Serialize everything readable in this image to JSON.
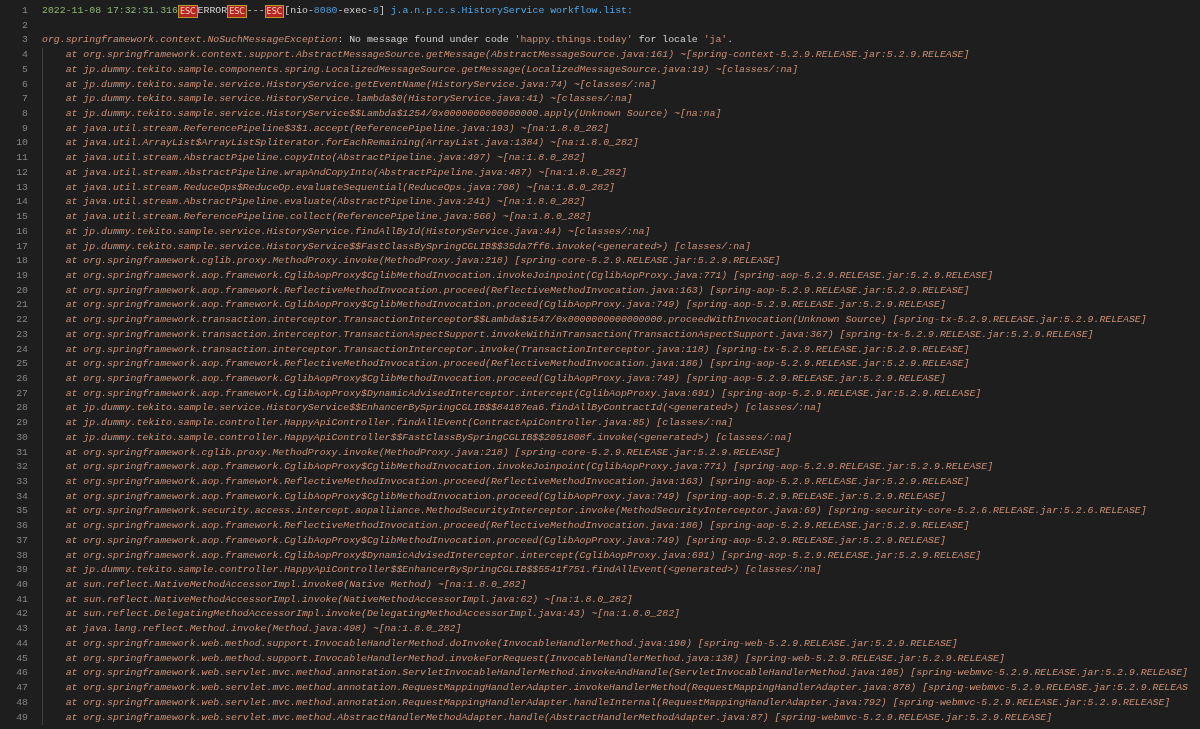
{
  "lines": [
    {
      "number": "1",
      "kind": "header",
      "segments": [
        {
          "kind": "timestamp",
          "text": "2022-11-08 17:32:31.316"
        },
        {
          "kind": "esc",
          "text": "ESC"
        },
        {
          "kind": "level",
          "text": "ERROR"
        },
        {
          "kind": "esc",
          "text": "ESC"
        },
        {
          "kind": "separator",
          "text": "---"
        },
        {
          "kind": "esc",
          "text": "ESC"
        },
        {
          "kind": "thread",
          "parts": [
            {
              "kind": "plain",
              "text": "[nio-"
            },
            {
              "kind": "number",
              "text": "8080"
            },
            {
              "kind": "plain",
              "text": "-exec-"
            },
            {
              "kind": "number",
              "text": "8"
            },
            {
              "kind": "plain",
              "text": "]"
            }
          ]
        },
        {
          "kind": "logger",
          "text": " j.a.n.p.c.s.HistoryService workflow.list:"
        }
      ]
    },
    {
      "number": "2",
      "kind": "blank"
    },
    {
      "number": "3",
      "kind": "exception",
      "segments": [
        {
          "kind": "class",
          "text": "org.springframework.context.NoSuchMessageException"
        },
        {
          "kind": "plain",
          "text": ": No message found under code "
        },
        {
          "kind": "string",
          "text": "'happy.things.today'"
        },
        {
          "kind": "plain",
          "text": " for locale "
        },
        {
          "kind": "string",
          "text": "'ja'"
        },
        {
          "kind": "plain",
          "text": "."
        }
      ]
    },
    {
      "number": "4",
      "kind": "trace",
      "text": "at org.springframework.context.support.AbstractMessageSource.getMessage(AbstractMessageSource.java:161) ~[spring-context-5.2.9.RELEASE.jar:5.2.9.RELEASE]"
    },
    {
      "number": "5",
      "kind": "trace",
      "text": "at jp.dummy.tekito.sample.components.spring.LocalizedMessageSource.getMessage(LocalizedMessageSource.java:19) ~[classes/:na]"
    },
    {
      "number": "6",
      "kind": "trace",
      "text": "at jp.dummy.tekito.sample.service.HistoryService.getEventName(HistoryService.java:74) ~[classes/:na]"
    },
    {
      "number": "7",
      "kind": "trace",
      "text": "at jp.dummy.tekito.sample.service.HistoryService.lambda$0(HistoryService.java:41) ~[classes/:na]"
    },
    {
      "number": "8",
      "kind": "trace",
      "text": "at jp.dummy.tekito.sample.service.HistoryService$$Lambda$1254/0x0000000000000000.apply(Unknown Source) ~[na:na]"
    },
    {
      "number": "9",
      "kind": "trace",
      "text": "at java.util.stream.ReferencePipeline$3$1.accept(ReferencePipeline.java:193) ~[na:1.8.0_282]"
    },
    {
      "number": "10",
      "kind": "trace",
      "text": "at java.util.ArrayList$ArrayListSpliterator.forEachRemaining(ArrayList.java:1384) ~[na:1.8.0_282]"
    },
    {
      "number": "11",
      "kind": "trace",
      "text": "at java.util.stream.AbstractPipeline.copyInto(AbstractPipeline.java:497) ~[na:1.8.0_282]"
    },
    {
      "number": "12",
      "kind": "trace",
      "text": "at java.util.stream.AbstractPipeline.wrapAndCopyInto(AbstractPipeline.java:487) ~[na:1.8.0_282]"
    },
    {
      "number": "13",
      "kind": "trace",
      "text": "at java.util.stream.ReduceOps$ReduceOp.evaluateSequential(ReduceOps.java:708) ~[na:1.8.0_282]"
    },
    {
      "number": "14",
      "kind": "trace",
      "text": "at java.util.stream.AbstractPipeline.evaluate(AbstractPipeline.java:241) ~[na:1.8.0_282]"
    },
    {
      "number": "15",
      "kind": "trace",
      "text": "at java.util.stream.ReferencePipeline.collect(ReferencePipeline.java:566) ~[na:1.8.0_282]"
    },
    {
      "number": "16",
      "kind": "trace",
      "text": "at jp.dummy.tekito.sample.service.HistoryService.findAllById(HistoryService.java:44) ~[classes/:na]"
    },
    {
      "number": "17",
      "kind": "trace",
      "text": "at jp.dummy.tekito.sample.service.HistoryService$$FastClassBySpringCGLIB$$35da7ff6.invoke(<generated>) [classes/:na]"
    },
    {
      "number": "18",
      "kind": "trace",
      "text": "at org.springframework.cglib.proxy.MethodProxy.invoke(MethodProxy.java:218) [spring-core-5.2.9.RELEASE.jar:5.2.9.RELEASE]"
    },
    {
      "number": "19",
      "kind": "trace",
      "text": "at org.springframework.aop.framework.CglibAopProxy$CglibMethodInvocation.invokeJoinpoint(CglibAopProxy.java:771) [spring-aop-5.2.9.RELEASE.jar:5.2.9.RELEASE]"
    },
    {
      "number": "20",
      "kind": "trace",
      "text": "at org.springframework.aop.framework.ReflectiveMethodInvocation.proceed(ReflectiveMethodInvocation.java:163) [spring-aop-5.2.9.RELEASE.jar:5.2.9.RELEASE]"
    },
    {
      "number": "21",
      "kind": "trace",
      "text": "at org.springframework.aop.framework.CglibAopProxy$CglibMethodInvocation.proceed(CglibAopProxy.java:749) [spring-aop-5.2.9.RELEASE.jar:5.2.9.RELEASE]"
    },
    {
      "number": "22",
      "kind": "trace",
      "text": "at org.springframework.transaction.interceptor.TransactionInterceptor$$Lambda$1547/0x0000000000000000.proceedWithInvocation(Unknown Source) [spring-tx-5.2.9.RELEASE.jar:5.2.9.RELEASE]"
    },
    {
      "number": "23",
      "kind": "trace",
      "text": "at org.springframework.transaction.interceptor.TransactionAspectSupport.invokeWithinTransaction(TransactionAspectSupport.java:367) [spring-tx-5.2.9.RELEASE.jar:5.2.9.RELEASE]"
    },
    {
      "number": "24",
      "kind": "trace",
      "text": "at org.springframework.transaction.interceptor.TransactionInterceptor.invoke(TransactionInterceptor.java:118) [spring-tx-5.2.9.RELEASE.jar:5.2.9.RELEASE]"
    },
    {
      "number": "25",
      "kind": "trace",
      "text": "at org.springframework.aop.framework.ReflectiveMethodInvocation.proceed(ReflectiveMethodInvocation.java:186) [spring-aop-5.2.9.RELEASE.jar:5.2.9.RELEASE]"
    },
    {
      "number": "26",
      "kind": "trace",
      "text": "at org.springframework.aop.framework.CglibAopProxy$CglibMethodInvocation.proceed(CglibAopProxy.java:749) [spring-aop-5.2.9.RELEASE.jar:5.2.9.RELEASE]"
    },
    {
      "number": "27",
      "kind": "trace",
      "text": "at org.springframework.aop.framework.CglibAopProxy$DynamicAdvisedInterceptor.intercept(CglibAopProxy.java:691) [spring-aop-5.2.9.RELEASE.jar:5.2.9.RELEASE]"
    },
    {
      "number": "28",
      "kind": "trace",
      "text": "at jp.dummy.tekito.sample.service.HistoryService$$EnhancerBySpringCGLIB$$84187ea6.findAllByContractId(<generated>) [classes/:na]"
    },
    {
      "number": "29",
      "kind": "trace",
      "text": "at jp.dummy.tekito.sample.controller.HappyApiController.findAllEvent(ContractApiController.java:85) [classes/:na]"
    },
    {
      "number": "30",
      "kind": "trace",
      "text": "at jp.dummy.tekito.sample.controller.HappyApiController$$FastClassBySpringCGLIB$$2051808f.invoke(<generated>) [classes/:na]"
    },
    {
      "number": "31",
      "kind": "trace",
      "text": "at org.springframework.cglib.proxy.MethodProxy.invoke(MethodProxy.java:218) [spring-core-5.2.9.RELEASE.jar:5.2.9.RELEASE]"
    },
    {
      "number": "32",
      "kind": "trace",
      "text": "at org.springframework.aop.framework.CglibAopProxy$CglibMethodInvocation.invokeJoinpoint(CglibAopProxy.java:771) [spring-aop-5.2.9.RELEASE.jar:5.2.9.RELEASE]"
    },
    {
      "number": "33",
      "kind": "trace",
      "text": "at org.springframework.aop.framework.ReflectiveMethodInvocation.proceed(ReflectiveMethodInvocation.java:163) [spring-aop-5.2.9.RELEASE.jar:5.2.9.RELEASE]"
    },
    {
      "number": "34",
      "kind": "trace",
      "text": "at org.springframework.aop.framework.CglibAopProxy$CglibMethodInvocation.proceed(CglibAopProxy.java:749) [spring-aop-5.2.9.RELEASE.jar:5.2.9.RELEASE]"
    },
    {
      "number": "35",
      "kind": "trace",
      "text": "at org.springframework.security.access.intercept.aopalliance.MethodSecurityInterceptor.invoke(MethodSecurityInterceptor.java:69) [spring-security-core-5.2.6.RELEASE.jar:5.2.6.RELEASE]"
    },
    {
      "number": "36",
      "kind": "trace",
      "text": "at org.springframework.aop.framework.ReflectiveMethodInvocation.proceed(ReflectiveMethodInvocation.java:186) [spring-aop-5.2.9.RELEASE.jar:5.2.9.RELEASE]"
    },
    {
      "number": "37",
      "kind": "trace",
      "text": "at org.springframework.aop.framework.CglibAopProxy$CglibMethodInvocation.proceed(CglibAopProxy.java:749) [spring-aop-5.2.9.RELEASE.jar:5.2.9.RELEASE]"
    },
    {
      "number": "38",
      "kind": "trace",
      "text": "at org.springframework.aop.framework.CglibAopProxy$DynamicAdvisedInterceptor.intercept(CglibAopProxy.java:691) [spring-aop-5.2.9.RELEASE.jar:5.2.9.RELEASE]"
    },
    {
      "number": "39",
      "kind": "trace",
      "text": "at jp.dummy.tekito.sample.controller.HappyApiController$$EnhancerBySpringCGLIB$$5541f751.findAllEvent(<generated>) [classes/:na]"
    },
    {
      "number": "40",
      "kind": "trace",
      "text": "at sun.reflect.NativeMethodAccessorImpl.invoke0(Native Method) ~[na:1.8.0_282]"
    },
    {
      "number": "41",
      "kind": "trace",
      "text": "at sun.reflect.NativeMethodAccessorImpl.invoke(NativeMethodAccessorImpl.java:62) ~[na:1.8.0_282]"
    },
    {
      "number": "42",
      "kind": "trace",
      "text": "at sun.reflect.DelegatingMethodAccessorImpl.invoke(DelegatingMethodAccessorImpl.java:43) ~[na:1.8.0_282]"
    },
    {
      "number": "43",
      "kind": "trace",
      "text": "at java.lang.reflect.Method.invoke(Method.java:498) ~[na:1.8.0_282]"
    },
    {
      "number": "44",
      "kind": "trace",
      "text": "at org.springframework.web.method.support.InvocableHandlerMethod.doInvoke(InvocableHandlerMethod.java:190) [spring-web-5.2.9.RELEASE.jar:5.2.9.RELEASE]"
    },
    {
      "number": "45",
      "kind": "trace",
      "text": "at org.springframework.web.method.support.InvocableHandlerMethod.invokeForRequest(InvocableHandlerMethod.java:138) [spring-web-5.2.9.RELEASE.jar:5.2.9.RELEASE]"
    },
    {
      "number": "46",
      "kind": "trace",
      "text": "at org.springframework.web.servlet.mvc.method.annotation.ServletInvocableHandlerMethod.invokeAndHandle(ServletInvocableHandlerMethod.java:105) [spring-webmvc-5.2.9.RELEASE.jar:5.2.9.RELEASE]"
    },
    {
      "number": "47",
      "kind": "trace",
      "text": "at org.springframework.web.servlet.mvc.method.annotation.RequestMappingHandlerAdapter.invokeHandlerMethod(RequestMappingHandlerAdapter.java:878) [spring-webmvc-5.2.9.RELEASE.jar:5.2.9.RELEAS"
    },
    {
      "number": "48",
      "kind": "trace",
      "text": "at org.springframework.web.servlet.mvc.method.annotation.RequestMappingHandlerAdapter.handleInternal(RequestMappingHandlerAdapter.java:792) [spring-webmvc-5.2.9.RELEASE.jar:5.2.9.RELEASE]"
    },
    {
      "number": "49",
      "kind": "trace",
      "text": "at org.springframework.web.servlet.mvc.method.AbstractHandlerMethodAdapter.handle(AbstractHandlerMethodAdapter.java:87) [spring-webmvc-5.2.9.RELEASE.jar:5.2.9.RELEASE]"
    }
  ]
}
